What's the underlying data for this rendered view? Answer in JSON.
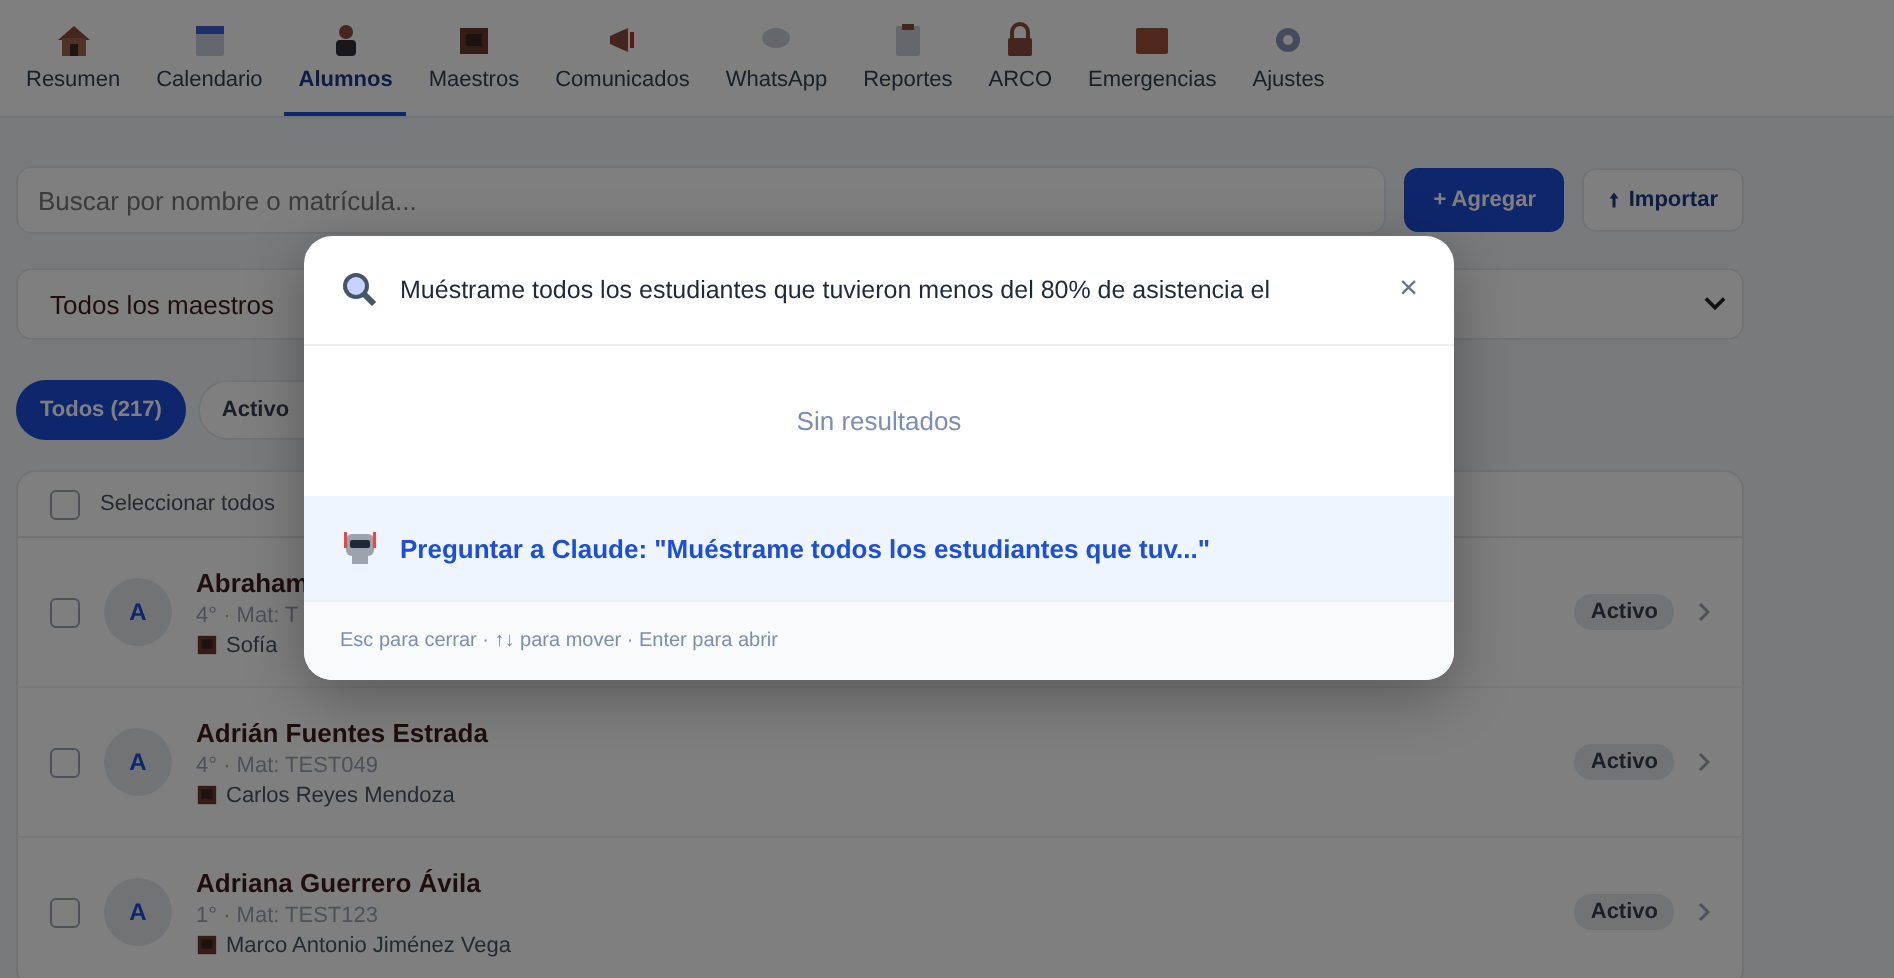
{
  "nav": {
    "tabs": [
      {
        "label": "Resumen",
        "selected": false
      },
      {
        "label": "Calendario",
        "selected": false
      },
      {
        "label": "Alumnos",
        "selected": true
      },
      {
        "label": "Maestros",
        "selected": false
      },
      {
        "label": "Comunicados",
        "selected": false
      },
      {
        "label": "WhatsApp",
        "selected": false
      },
      {
        "label": "Reportes",
        "selected": false
      },
      {
        "label": "ARCO",
        "selected": false
      },
      {
        "label": "Emergencias",
        "selected": false
      },
      {
        "label": "Ajustes",
        "selected": false
      }
    ]
  },
  "toolbar": {
    "search": {
      "placeholder": "Buscar por nombre o matrícula..."
    },
    "buttons": [
      {
        "label": "+ Agregar",
        "kind": "primary"
      },
      {
        "label": "Importar",
        "kind": "secondary"
      }
    ]
  },
  "filter": {
    "value": "Todos los maestros"
  },
  "chips": [
    {
      "label": "Todos (217)",
      "selected": true
    },
    {
      "label": "Activo",
      "selected": false
    }
  ],
  "list": {
    "select_all_label": "Seleccionar todos",
    "select_all_checked": false,
    "rows": [
      {
        "initial": "A",
        "name": "Abraham",
        "detail": "4° · Mat: T",
        "teacher": "Sofía",
        "status": "Activo",
        "checked": false
      },
      {
        "initial": "A",
        "name": "Adrián Fuentes Estrada",
        "detail": "4° · Mat: TEST049",
        "teacher": "Carlos Reyes Mendoza",
        "status": "Activo",
        "checked": false
      },
      {
        "initial": "A",
        "name": "Adriana Guerrero Ávila",
        "detail": "1° · Mat: TEST123",
        "teacher": "Marco Antonio Jiménez Vega",
        "status": "Activo",
        "checked": false
      }
    ]
  },
  "palette": {
    "query": "Muéstrame todos los estudiantes que tuvieron menos del 80% de asistencia el",
    "close": "×",
    "empty_text": "Sin resultados",
    "ask_label": "Preguntar a Claude: \"Muéstrame todos los estudiantes que tuv...\"",
    "footer": "Esc para cerrar · ↑↓ para mover · Enter para abrir"
  }
}
